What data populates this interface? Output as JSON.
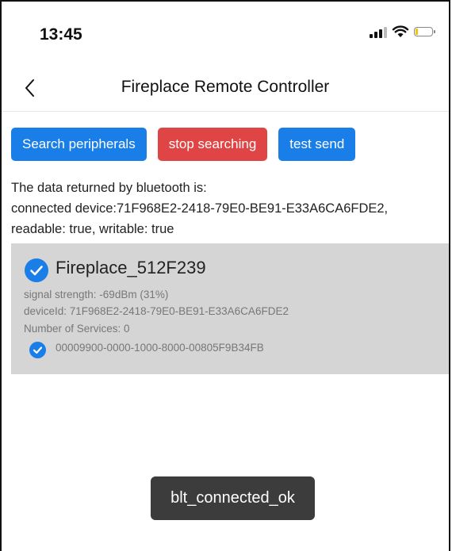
{
  "status_bar": {
    "time": "13:45",
    "icons": [
      "signal-icon",
      "wifi-icon",
      "battery-icon"
    ]
  },
  "nav": {
    "back_icon": "chevron-left-icon",
    "title": "Fireplace Remote Controller"
  },
  "buttons": {
    "search": "Search peripherals",
    "stop": "stop searching",
    "test": "test send"
  },
  "info": {
    "line1": "The data returned by bluetooth is:",
    "line2": "connected device:71F968E2-2418-79E0-BE91-E33A6CA6FDE2,",
    "line3": "readable: true, writable: true"
  },
  "device": {
    "name": "Fireplace_512F239",
    "signal": "signal strength: -69dBm (31%)",
    "device_id": "deviceId: 71F968E2-2418-79E0-BE91-E33A6CA6FDE2",
    "services": "Number of Services: 0",
    "service_uuid": "00009900-0000-1000-8000-00805F9B34FB"
  },
  "toast": {
    "message": "blt_connected_ok"
  },
  "colors": {
    "primary_blue": "#1a7ee8",
    "danger_red": "#e04545",
    "card_gray": "#d5d5d5",
    "toast_bg": "#3c3c3c"
  }
}
